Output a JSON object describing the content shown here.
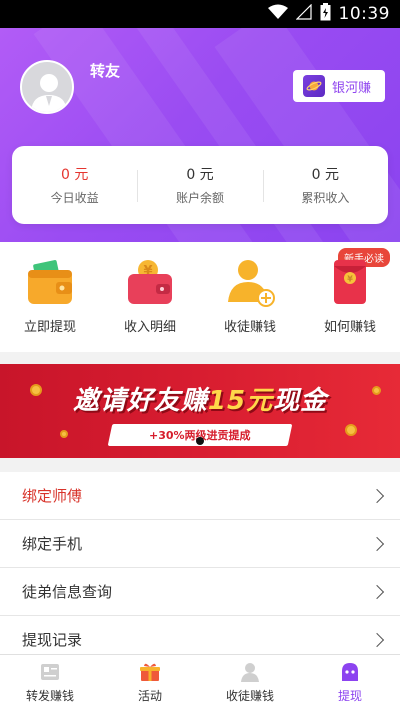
{
  "status_bar": {
    "time": "10:39"
  },
  "header": {
    "username": "转友",
    "galaxy_button": "银河赚"
  },
  "stats": [
    {
      "value": "0 元",
      "label": "今日收益",
      "highlight": true
    },
    {
      "value": "0 元",
      "label": "账户余额",
      "highlight": false
    },
    {
      "value": "0 元",
      "label": "累积收入",
      "highlight": false
    }
  ],
  "actions": [
    {
      "label": "立即提现",
      "icon": "wallet-icon"
    },
    {
      "label": "收入明细",
      "icon": "coin-purse-icon"
    },
    {
      "label": "收徒赚钱",
      "icon": "add-user-icon"
    },
    {
      "label": "如何赚钱",
      "icon": "red-envelope-icon",
      "badge": "新手必读"
    }
  ],
  "banner": {
    "title_prefix": "邀请好友赚",
    "title_highlight": "15元",
    "title_suffix": "现金",
    "subtitle": "+30%两级进贡提成"
  },
  "menu": [
    {
      "label": "绑定师傅",
      "highlight": true
    },
    {
      "label": "绑定手机",
      "highlight": false
    },
    {
      "label": "徒弟信息查询",
      "highlight": false
    },
    {
      "label": "提现记录",
      "highlight": false
    }
  ],
  "tabs": [
    {
      "label": "转发赚钱",
      "icon": "share-card-icon",
      "active": false
    },
    {
      "label": "活动",
      "icon": "gift-icon",
      "active": false
    },
    {
      "label": "收徒赚钱",
      "icon": "user-icon",
      "active": false
    },
    {
      "label": "提现",
      "icon": "ghost-face-icon",
      "active": true
    }
  ],
  "colors": {
    "brand_purple": "#9a4cf2",
    "accent_red": "#e5352f",
    "banner_red": "#d81d30"
  }
}
